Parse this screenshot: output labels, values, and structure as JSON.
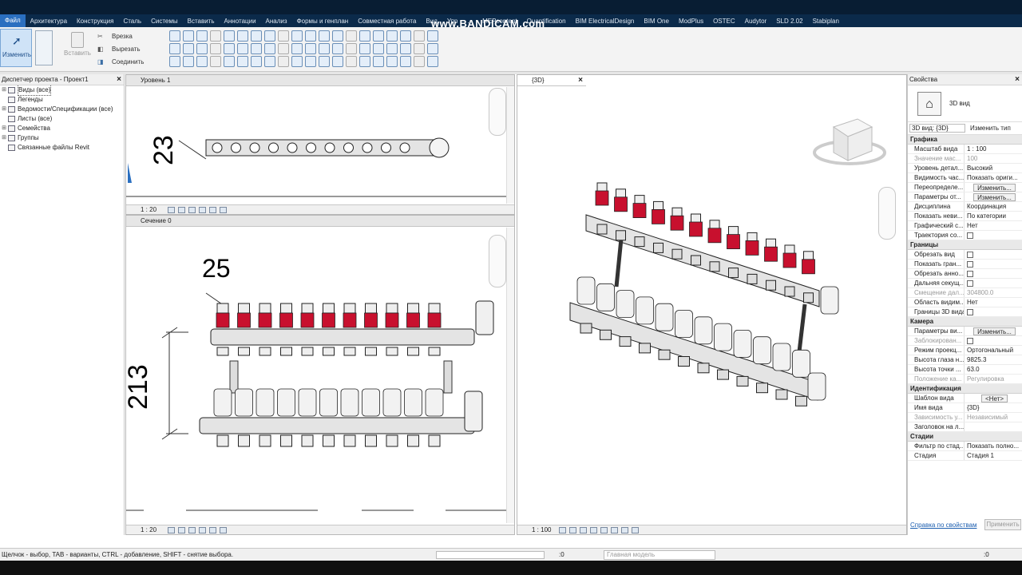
{
  "menu": [
    "Файл",
    "Архитектура",
    "Конструкция",
    "Сталь",
    "Системы",
    "Вставить",
    "Аннотации",
    "Анализ",
    "Формы и генплан",
    "Совместная работа",
    "Вид",
    "Упр",
    "...",
    "MEPcontent",
    "Quantification",
    "BIM ElectricalDesign",
    "BIM One",
    "ModPlus",
    "OSTEC",
    "Audytor",
    "SLD 2.02",
    "Stabiplan"
  ],
  "watermark": "www.BANDICAM.com",
  "ribbon": {
    "modify": "Изменить",
    "paste": "Вставить",
    "cut_section": "Врезка",
    "cut": "Вырезать",
    "join": "Соединить"
  },
  "browser": {
    "title": "Диспетчер проекта - Проект1",
    "items": [
      {
        "label": "Виды (все)",
        "exp": "⊞"
      },
      {
        "label": "Легенды",
        "exp": ""
      },
      {
        "label": "Ведомости/Спецификации (все)",
        "exp": "⊞"
      },
      {
        "label": "Листы (все)",
        "exp": ""
      },
      {
        "label": "Семейства",
        "exp": "⊞"
      },
      {
        "label": "Группы",
        "exp": "⊞"
      },
      {
        "label": "Связанные файлы Revit",
        "exp": ""
      }
    ]
  },
  "views": {
    "plan": {
      "title": "Уровень 1",
      "scale": "1 : 20",
      "dim": "23"
    },
    "section": {
      "title": "Сечение 0",
      "scale": "1 : 20",
      "dim1": "25",
      "dim2": "213"
    },
    "v3d": {
      "title": "{3D}",
      "scale": "1 : 100"
    }
  },
  "props": {
    "title": "Свойства",
    "type_name": "3D вид",
    "selector": "3D вид: {3D}",
    "edit_type": "Изменить тип",
    "sections": [
      {
        "name": "Графика",
        "rows": [
          {
            "k": "Масштаб вида",
            "v": "1 : 100",
            "dim": false
          },
          {
            "k": "Значение мас...",
            "v": "100",
            "dim": true
          },
          {
            "k": "Уровень детал...",
            "v": "Высокий",
            "dim": false
          },
          {
            "k": "Видимость час...",
            "v": "Показать ориги...",
            "dim": false
          },
          {
            "k": "Переопределе...",
            "v": "Изменить...",
            "dim": false,
            "btn": true
          },
          {
            "k": "Параметры от...",
            "v": "Изменить...",
            "dim": false,
            "btn": true
          },
          {
            "k": "Дисциплина",
            "v": "Координация",
            "dim": false
          },
          {
            "k": "Показать неви...",
            "v": "По категории",
            "dim": false
          },
          {
            "k": "Графический с...",
            "v": "Нет",
            "dim": false
          },
          {
            "k": "Траектория со...",
            "v": "",
            "dim": false,
            "chk": true
          }
        ]
      },
      {
        "name": "Границы",
        "rows": [
          {
            "k": "Обрезать вид",
            "v": "",
            "chk": true
          },
          {
            "k": "Показать гран...",
            "v": "",
            "chk": true
          },
          {
            "k": "Обрезать анно...",
            "v": "",
            "chk": true
          },
          {
            "k": "Дальняя секущ...",
            "v": "",
            "chk": true
          },
          {
            "k": "Смещение дал...",
            "v": "304800.0",
            "dim": true
          },
          {
            "k": "Область видим...",
            "v": "Нет"
          },
          {
            "k": "Границы 3D вида",
            "v": "",
            "chk": true
          }
        ]
      },
      {
        "name": "Камера",
        "rows": [
          {
            "k": "Параметры ви...",
            "v": "Изменить...",
            "btn": true
          },
          {
            "k": "Заблокирован...",
            "v": "",
            "dim": true,
            "chk": true
          },
          {
            "k": "Режим проекц...",
            "v": "Ортогональный"
          },
          {
            "k": "Высота глаза н...",
            "v": "9825.3"
          },
          {
            "k": "Высота точки ...",
            "v": "63.0"
          },
          {
            "k": "Положение ка...",
            "v": "Регулировка",
            "dim": true
          }
        ]
      },
      {
        "name": "Идентификация",
        "rows": [
          {
            "k": "Шаблон вида",
            "v": "<Нет>",
            "btn": true
          },
          {
            "k": "Имя вида",
            "v": "{3D}"
          },
          {
            "k": "Зависимость у...",
            "v": "Независимый",
            "dim": true
          },
          {
            "k": "Заголовок на л...",
            "v": ""
          }
        ]
      },
      {
        "name": "Стадии",
        "rows": [
          {
            "k": "Фильтр по стад...",
            "v": "Показать полно..."
          },
          {
            "k": "Стадия",
            "v": "Стадия 1"
          }
        ]
      }
    ],
    "help": "Справка по свойствам",
    "apply": "Применить"
  },
  "status": {
    "text": "Щелчок - выбор, TAB - варианты, CTRL - добавление, SHIFT - снятие выбора.",
    "count": ":0",
    "model": "Главная модель",
    "filter": ":0"
  },
  "colors": {
    "accent": "#2a6fc0",
    "valve": "#c8102e"
  }
}
